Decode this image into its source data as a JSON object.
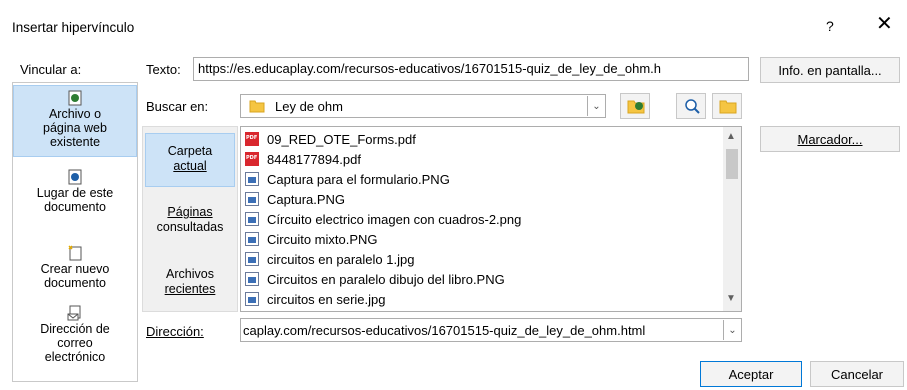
{
  "dialog": {
    "title": "Insertar hipervínculo",
    "help": "?",
    "close": "✕"
  },
  "link_to": {
    "label": "Vincular a:",
    "items": [
      {
        "label_lines": [
          "Archivo o",
          "página web",
          "existente"
        ],
        "icon": "file-web-icon",
        "selected": true
      },
      {
        "label_lines": [
          "Lugar de este",
          "documento"
        ],
        "icon": "place-in-document-icon",
        "selected": false
      },
      {
        "label_lines": [
          "Crear nuevo",
          "documento"
        ],
        "icon": "new-document-icon",
        "selected": false
      },
      {
        "label_lines": [
          "Dirección de",
          "correo",
          "electrónico"
        ],
        "icon": "email-icon",
        "selected": false
      }
    ]
  },
  "text_field": {
    "label": "Texto:",
    "value": "https://es.educaplay.com/recursos-educativos/16701515-quiz_de_ley_de_ohm.h"
  },
  "screentip_button": "Info. en pantalla...",
  "look_in": {
    "label": "Buscar en:",
    "value": "Ley de ohm"
  },
  "bookmark_button": "Marcador...",
  "folder_nav": [
    {
      "label_lines": [
        "Carpeta",
        "actual"
      ],
      "selected": true
    },
    {
      "label_lines": [
        "Páginas",
        "consultadas"
      ],
      "selected": false
    },
    {
      "label_lines": [
        "Archivos",
        "recientes"
      ],
      "selected": false
    }
  ],
  "files": [
    {
      "name": "09_RED_OTE_Forms.pdf",
      "type": "pdf"
    },
    {
      "name": "8448177894.pdf",
      "type": "pdf"
    },
    {
      "name": "Captura para el formulario.PNG",
      "type": "image"
    },
    {
      "name": "Captura.PNG",
      "type": "image"
    },
    {
      "name": "Círcuito electrico imagen con cuadros-2.png",
      "type": "image"
    },
    {
      "name": "Circuito mixto.PNG",
      "type": "image"
    },
    {
      "name": "circuitos en paralelo 1.jpg",
      "type": "image"
    },
    {
      "name": "Circuitos en paralelo dibujo del libro.PNG",
      "type": "image"
    },
    {
      "name": "circuitos en serie.jpg",
      "type": "image"
    }
  ],
  "address": {
    "label": "Dirección:",
    "value": "caplay.com/recursos-educativos/16701515-quiz_de_ley_de_ohm.html"
  },
  "ok_button": "Aceptar",
  "cancel_button": "Cancelar"
}
